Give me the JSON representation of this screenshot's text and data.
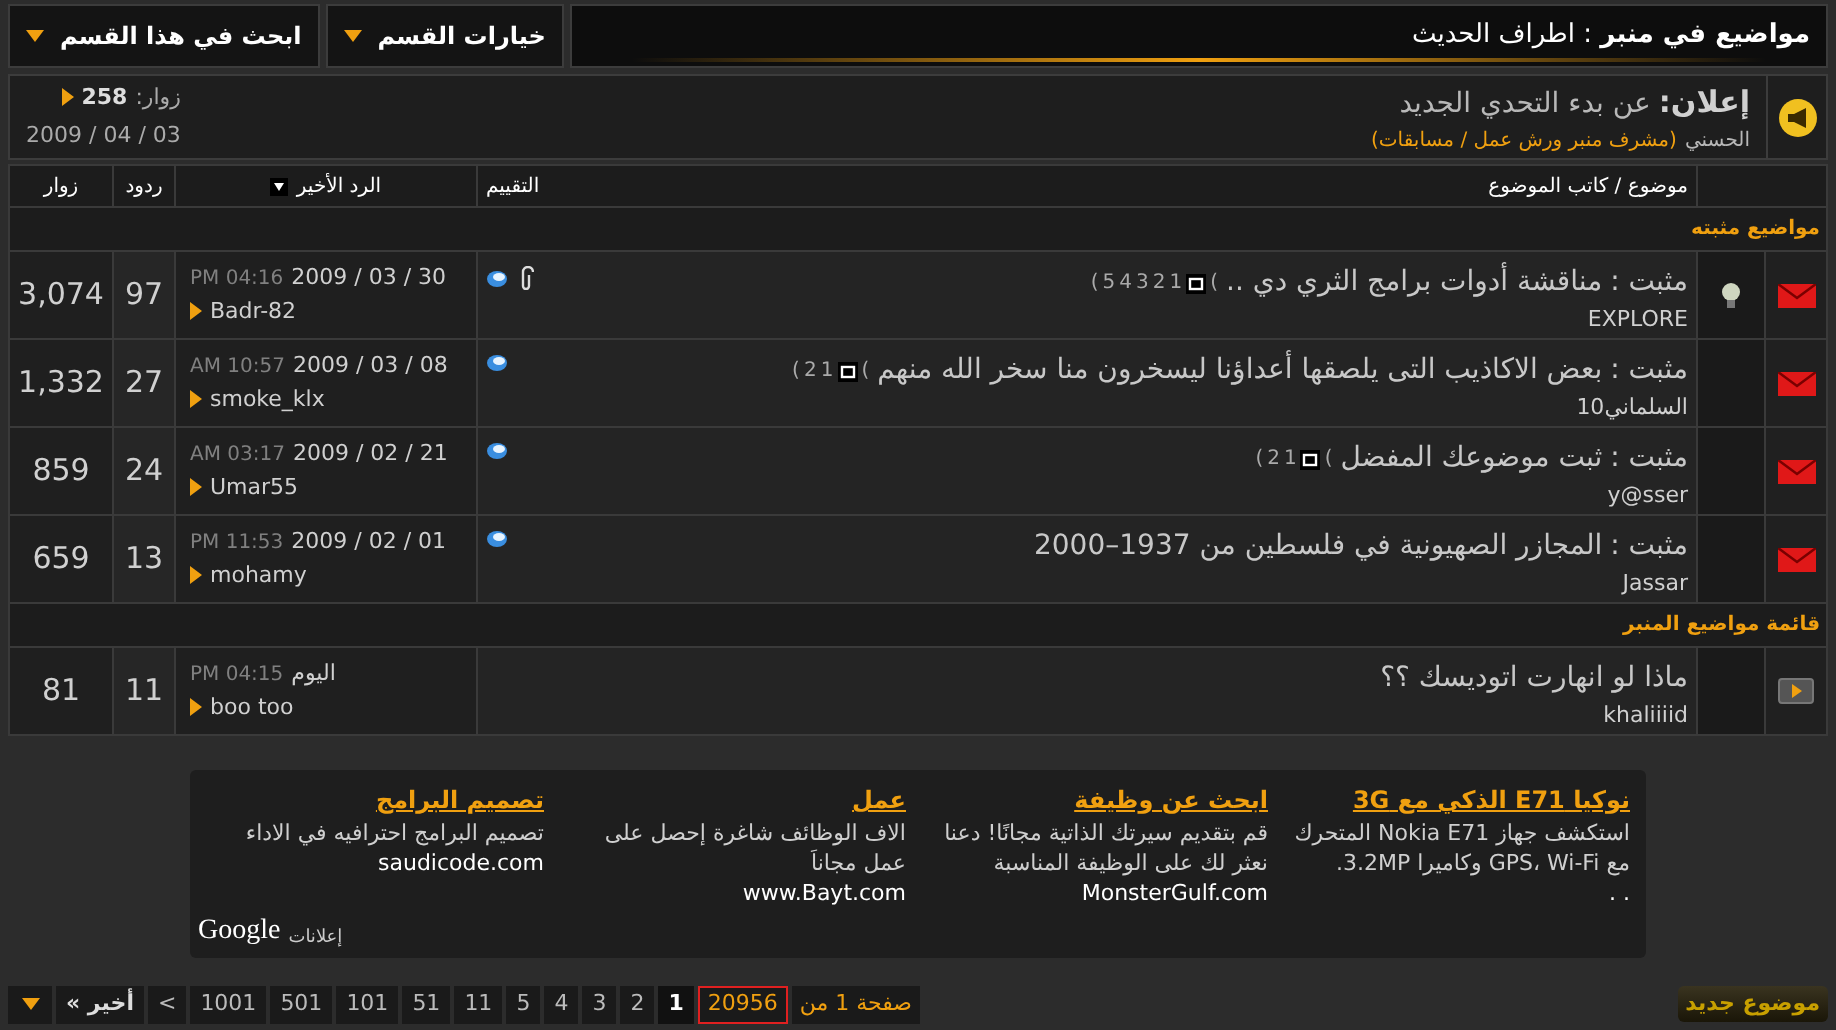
{
  "top_bar": {
    "title": "**مواضيع في منبر** : اطراف الحديث",
    "buttons": [
      {
        "label": "خيارات القسم"
      },
      {
        "label": "ابحث في هذا القسم"
      }
    ]
  },
  "announcement": {
    "label": "إعلان:",
    "title": "عن بدء التحدي الجديد",
    "author": "الحسني",
    "role": "(مشرف منبر ورش عمل / مسابقات)",
    "views_label": "زوار:",
    "views": "258",
    "date": "03 / 04 / 2009"
  },
  "columns": {
    "title": "موضوع / كاتب الموضوع",
    "rating": "التقييم",
    "last_reply": "الرد الأخير",
    "replies": "ردود",
    "views": "زوار"
  },
  "sections": [
    {
      "title": "مواضيع مثبته",
      "threads": [
        {
          "kind": "sticky",
          "bulb": true,
          "prefix": "مثبت :",
          "title": "مناقشة أدوات برامج الثري دي ..",
          "pages": [
            "1",
            "2",
            "3",
            "4",
            "5"
          ],
          "pages_open": "(",
          "pages_close": "(",
          "author": "EXPLORE",
          "rated": true,
          "attachment": true,
          "date": "2009 / 03 / 30",
          "time": "PM 04:16",
          "last_user": "Badr-82",
          "replies": "97",
          "views": "3,074"
        },
        {
          "kind": "sticky",
          "prefix": "مثبت :",
          "bulb": false,
          "title": "بعض الاكاذيب التى يلصقها أعداؤنا ليسخرون منا سخر الله منهم",
          "pages": [
            "1",
            "2"
          ],
          "pages_open": "(",
          "pages_close": "(",
          "author": "السلماني10",
          "rated": true,
          "attachment": false,
          "date": "2009 / 03 / 08",
          "time": "AM 10:57",
          "last_user": "smoke_klx",
          "replies": "27",
          "views": "1,332"
        },
        {
          "kind": "sticky",
          "prefix": "مثبت :",
          "bulb": false,
          "title": "ثبت موضوعك المفضل",
          "pages": [
            "1",
            "2"
          ],
          "pages_open": "(",
          "pages_close": "(",
          "author": "y@sser",
          "rated": true,
          "attachment": false,
          "date": "2009 / 02 / 21",
          "time": "AM 03:17",
          "last_user": "Umar55",
          "replies": "24",
          "views": "859"
        },
        {
          "kind": "sticky",
          "prefix": "مثبت :",
          "bulb": false,
          "title": "المجازر الصهيونية في فلسطين من 1937–2000",
          "author": "Jassar",
          "rated": true,
          "attachment": false,
          "date": "2009 / 02 / 01",
          "time": "PM 11:53",
          "last_user": "mohamy",
          "replies": "13",
          "views": "659"
        }
      ]
    },
    {
      "title": "قائمة مواضيع المنبر",
      "threads": [
        {
          "kind": "normal",
          "bulb": false,
          "title": "ماذا لو انهارت اتوديسك ؟؟",
          "author": "khaliiiid",
          "rated": false,
          "attachment": false,
          "date": "اليوم",
          "time": "PM 04:15",
          "last_user": "boo too",
          "replies": "11",
          "views": "81"
        }
      ]
    }
  ],
  "ads": {
    "items": [
      {
        "title": "نوكيا E71 الذكي مع 3G",
        "body": "استكشف جهاز Nokia E71 المتحرك مع GPS، Wi-Fi وكاميرا 3.2MP.",
        "url": ". ."
      },
      {
        "title": "ابحث عن وظيفة",
        "body": "قم بتقديم سيرتك الذاتية مجانًا! دعنا نعثر لك على الوظيفة المناسبة",
        "url": "MonsterGulf.com"
      },
      {
        "title": "عمل",
        "body": "الاف الوظائف شاغرة إحصل على عمل مجاناَ",
        "url": "www.Bayt.com"
      },
      {
        "title": "تصميم البرامج",
        "body": "تصميم البرامج احترافيه في الاداء",
        "url": "saudicode.com"
      }
    ],
    "label": "إعلانات",
    "brand": "Google"
  },
  "new_thread": "موضوع جديد",
  "pager": {
    "label": "صفحة 1 من",
    "total": "20956",
    "pages": [
      {
        "label": "1",
        "selected": true
      },
      {
        "label": "2",
        "selected": false
      },
      {
        "label": "3",
        "selected": false
      },
      {
        "label": "4",
        "selected": false
      },
      {
        "label": "5",
        "selected": false
      },
      {
        "label": "11",
        "selected": false
      },
      {
        "label": "51",
        "selected": false
      },
      {
        "label": "101",
        "selected": false
      },
      {
        "label": "501",
        "selected": false
      },
      {
        "label": "1001",
        "selected": false
      }
    ],
    "next": ">",
    "last": "أخير »"
  }
}
